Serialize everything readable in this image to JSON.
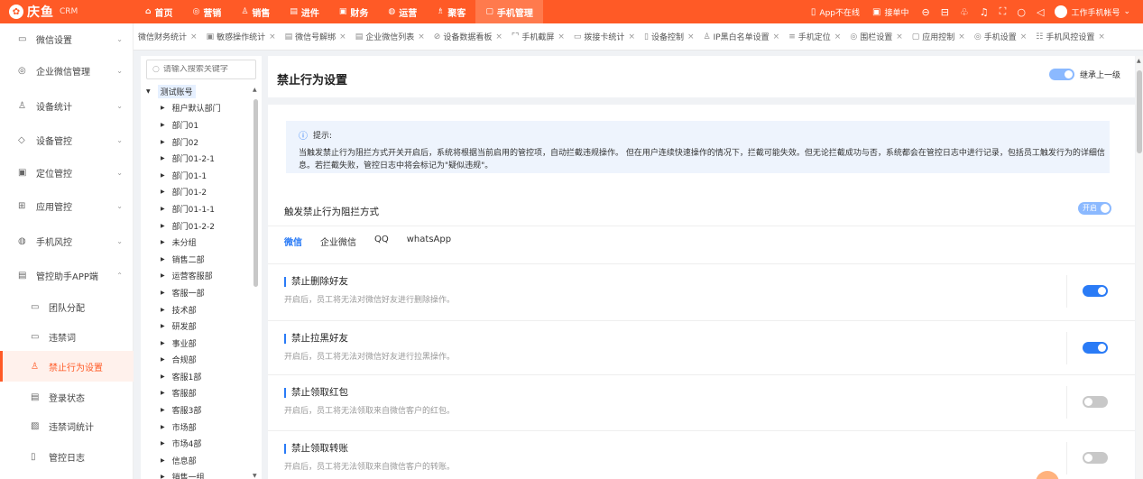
{
  "topbar": {
    "brand": "庆鱼",
    "brand_sub": "CRM",
    "nav": [
      {
        "label": "首页",
        "icon": "⌂"
      },
      {
        "label": "营销",
        "icon": "◎"
      },
      {
        "label": "销售",
        "icon": "♙"
      },
      {
        "label": "进件",
        "icon": "▤"
      },
      {
        "label": "财务",
        "icon": "▣"
      },
      {
        "label": "运营",
        "icon": "◍"
      },
      {
        "label": "聚客",
        "icon": "♗"
      },
      {
        "label": "手机管理",
        "icon": "▢"
      }
    ],
    "app_status": "App不在线",
    "receive": "接单中",
    "account": "工作手机帐号"
  },
  "left_menu": [
    {
      "label": "微信设置",
      "icon": "▭",
      "chev": "⌄"
    },
    {
      "label": "企业微信管理",
      "icon": "◎",
      "chev": "⌄"
    },
    {
      "label": "设备统计",
      "icon": "♙",
      "chev": "⌄"
    },
    {
      "label": "设备管控",
      "icon": "◇",
      "chev": "⌄"
    },
    {
      "label": "定位管控",
      "icon": "▣",
      "chev": "⌄"
    },
    {
      "label": "应用管控",
      "icon": "⊞",
      "chev": "⌄"
    },
    {
      "label": "手机风控",
      "icon": "◍",
      "chev": "⌄"
    },
    {
      "label": "管控助手APP端",
      "icon": "▤",
      "chev": "⌃"
    },
    {
      "label": "团队分配",
      "icon": "▭"
    },
    {
      "label": "违禁词",
      "icon": "▭"
    },
    {
      "label": "禁止行为设置",
      "icon": "♙"
    },
    {
      "label": "登录状态",
      "icon": "▤"
    },
    {
      "label": "违禁词统计",
      "icon": "▨"
    },
    {
      "label": "管控日志",
      "icon": "▯"
    }
  ],
  "tabs": [
    {
      "label": "微信财务统计",
      "icon": ""
    },
    {
      "label": "敏感操作统计",
      "icon": "▣"
    },
    {
      "label": "微信号解绑",
      "icon": "▤"
    },
    {
      "label": "企业微信列表",
      "icon": "▤"
    },
    {
      "label": "设备数据看板",
      "icon": "⊘"
    },
    {
      "label": "手机截屏",
      "icon": "⌜⌝"
    },
    {
      "label": "拨接卡统计",
      "icon": "▭"
    },
    {
      "label": "设备控制",
      "icon": "▯"
    },
    {
      "label": "IP黑白名单设置",
      "icon": "♙"
    },
    {
      "label": "手机定位",
      "icon": "≡"
    },
    {
      "label": "围栏设置",
      "icon": "◎"
    },
    {
      "label": "应用控制",
      "icon": "▢"
    },
    {
      "label": "手机设置",
      "icon": "◎"
    },
    {
      "label": "手机风控设置",
      "icon": "☷"
    }
  ],
  "tree": {
    "search_placeholder": "请输入搜索关键字",
    "root": "测试账号",
    "nodes": [
      "租户默认部门",
      "部门01",
      "部门02",
      "部门01-2-1",
      "部门01-1",
      "部门01-2",
      "部门01-1-1",
      "部门01-2-2",
      "未分组",
      "销售二部",
      "运营客服部",
      "客服一部",
      "技术部",
      "研发部",
      "事业部",
      "合规部",
      "客服1部",
      "客服部",
      "客服3部",
      "市场部",
      "市场4部",
      "信息部",
      "销售一组"
    ]
  },
  "main": {
    "title": "禁止行为设置",
    "inherit_label": "继承上一级",
    "tip_title": "提示:",
    "tip_body": "当触发禁止行为阻拦方式开关开启后，系统将根据当前启用的管控项，自动拦截违规操作。 但在用户连续快速操作的情况下，拦截可能失效。但无论拦截成功与否，系统都会在管控日志中进行记录，包括员工触发行为的详细信息。若拦截失败，管控日志中将会标记为\"疑似违规\"。",
    "section_title": "触发禁止行为阻拦方式",
    "section_switch": "开启",
    "sub_tabs": [
      "微信",
      "企业微信",
      "QQ",
      "whatsApp"
    ],
    "rules": [
      {
        "title": "禁止删除好友",
        "desc": "开启后，员工将无法对微信好友进行删除操作。",
        "on": true
      },
      {
        "title": "禁止拉黑好友",
        "desc": "开启后，员工将无法对微信好友进行拉黑操作。",
        "on": true
      },
      {
        "title": "禁止领取红包",
        "desc": "开启后，员工将无法领取来自微信客户的红包。",
        "on": false
      },
      {
        "title": "禁止领取转账",
        "desc": "开启后，员工将无法领取来自微信客户的转账。",
        "on": false
      }
    ]
  },
  "colors": {
    "brand": "#ff5a26",
    "accent": "#2a7bf6"
  }
}
